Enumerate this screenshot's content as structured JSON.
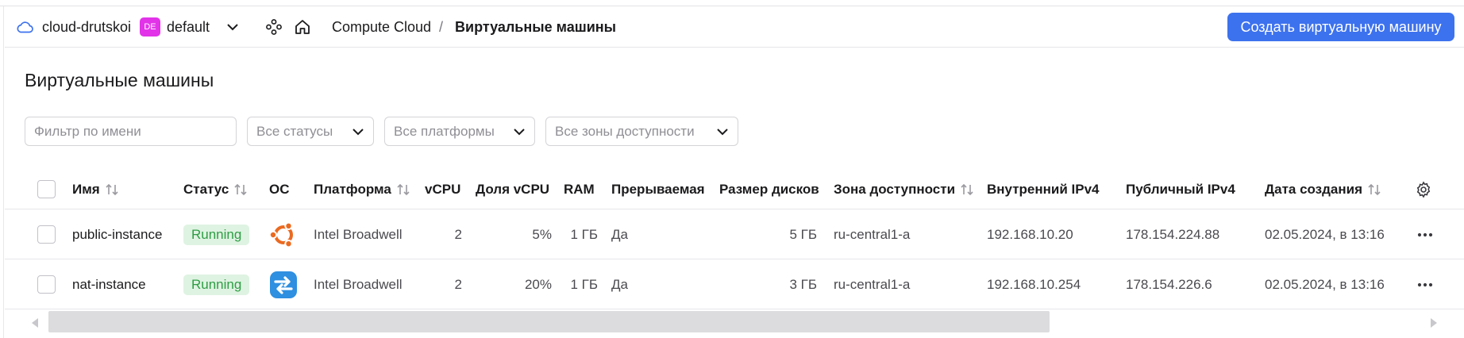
{
  "header": {
    "cloud_name": "cloud-drutskoi",
    "folder_badge": "DE",
    "folder_badge_color": "#e233e9",
    "folder_name": "default",
    "breadcrumb_service": "Compute Cloud",
    "breadcrumb_separator": "/",
    "breadcrumb_current": "Виртуальные машины",
    "create_button": "Создать виртуальную машину",
    "accent_color": "#3d72ee"
  },
  "page": {
    "title": "Виртуальные машины"
  },
  "filters": {
    "name_placeholder": "Фильтр по имени",
    "status": "Все статусы",
    "platform": "Все платформы",
    "zone": "Все зоны доступности"
  },
  "table": {
    "columns": {
      "name": "Имя",
      "status": "Статус",
      "os": "ОС",
      "platform": "Платформа",
      "vcpu": "vCPU",
      "vcpu_share": "Доля vCPU",
      "ram": "RAM",
      "preemptible": "Прерываемая",
      "disk_size": "Размер дисков",
      "zone": "Зона доступности",
      "internal_ip": "Внутренний IPv4",
      "public_ip": "Публичный IPv4",
      "created": "Дата создания"
    },
    "rows": [
      {
        "name": "public-instance",
        "status": "Running",
        "os_icon": "ubuntu-icon",
        "platform": "Intel Broadwell",
        "vcpu": "2",
        "vcpu_share": "5%",
        "ram": "1 ГБ",
        "preemptible": "Да",
        "disk_size": "5 ГБ",
        "zone": "ru-central1-a",
        "internal_ip": "192.168.10.20",
        "public_ip": "178.154.224.88",
        "created": "02.05.2024, в 13:16"
      },
      {
        "name": "nat-instance",
        "status": "Running",
        "os_icon": "nat-instance-icon",
        "platform": "Intel Broadwell",
        "vcpu": "2",
        "vcpu_share": "20%",
        "ram": "1 ГБ",
        "preemptible": "Да",
        "disk_size": "3 ГБ",
        "zone": "ru-central1-a",
        "internal_ip": "192.168.10.254",
        "public_ip": "178.154.226.6",
        "created": "02.05.2024, в 13:16"
      }
    ]
  },
  "status_colors": {
    "running_bg": "#dff3e2",
    "running_text": "#2e9d44"
  }
}
